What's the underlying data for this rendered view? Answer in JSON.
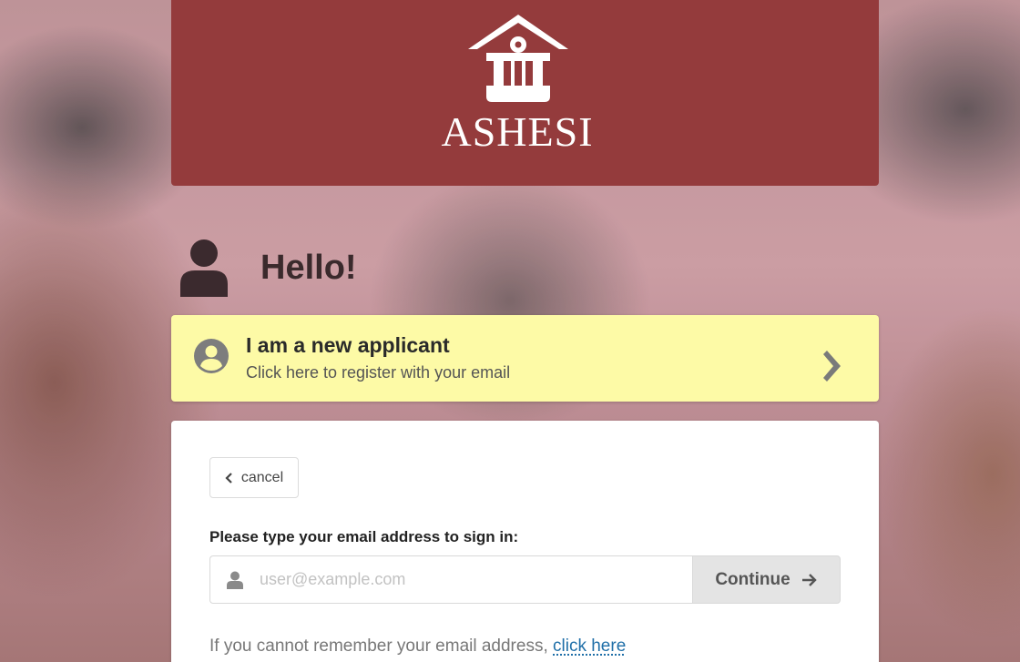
{
  "header": {
    "brand_name": "ASHESI",
    "background_color": "#943b3c",
    "logo_icon": "ashesi-logo-icon"
  },
  "greeting": {
    "text": "Hello!",
    "icon": "user-icon"
  },
  "new_applicant": {
    "title": "I am a new applicant",
    "subtitle": "Click here to register with your email",
    "background_color": "#fdfaa6",
    "icon": "user-circle-icon",
    "arrow_icon": "chevron-right-icon"
  },
  "signin": {
    "cancel_label": "cancel",
    "email_label": "Please type your email address to sign in:",
    "email_value": "",
    "email_placeholder": "user@example.com",
    "continue_label": "Continue",
    "forgot_text": "If you cannot remember your email address,",
    "forgot_link": "click here"
  },
  "colors": {
    "link": "#1f6fa8",
    "continue_bg": "#e4e4e4"
  }
}
